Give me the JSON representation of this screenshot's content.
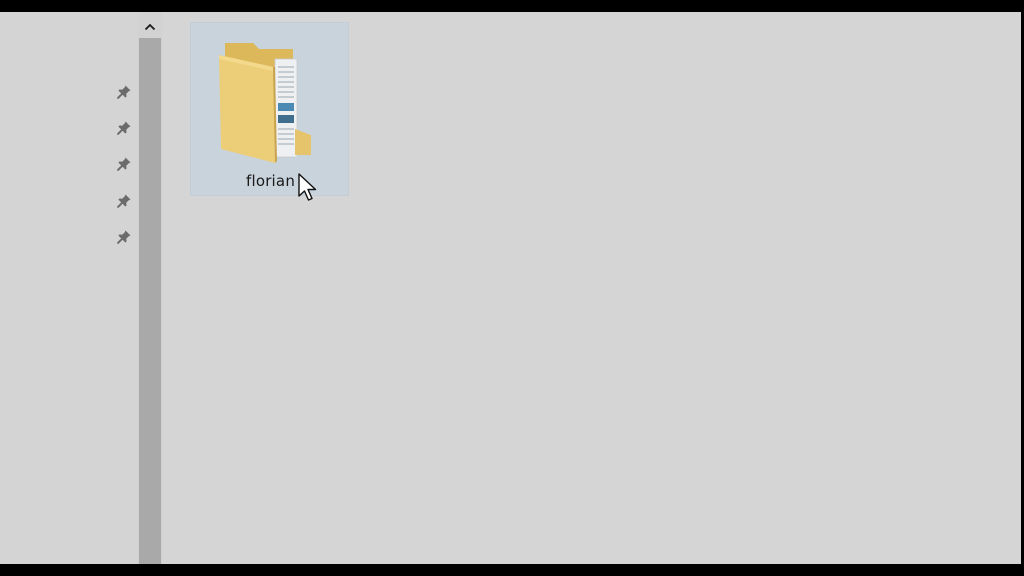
{
  "nav_pane": {
    "pins": [
      {
        "icon": "pin-icon"
      },
      {
        "icon": "pin-icon"
      },
      {
        "icon": "pin-icon"
      },
      {
        "icon": "pin-icon"
      },
      {
        "icon": "pin-icon"
      }
    ]
  },
  "scrollbar": {
    "up_icon": "chevron-up-icon"
  },
  "content": {
    "items": [
      {
        "name": "florian",
        "icon": "folder-icon",
        "selected": true
      }
    ]
  },
  "colors": {
    "background": "#d4d4d4",
    "selection": "#c9d3dc",
    "folder": "#e7c76e",
    "scroll_thumb": "#a9a9a9"
  }
}
